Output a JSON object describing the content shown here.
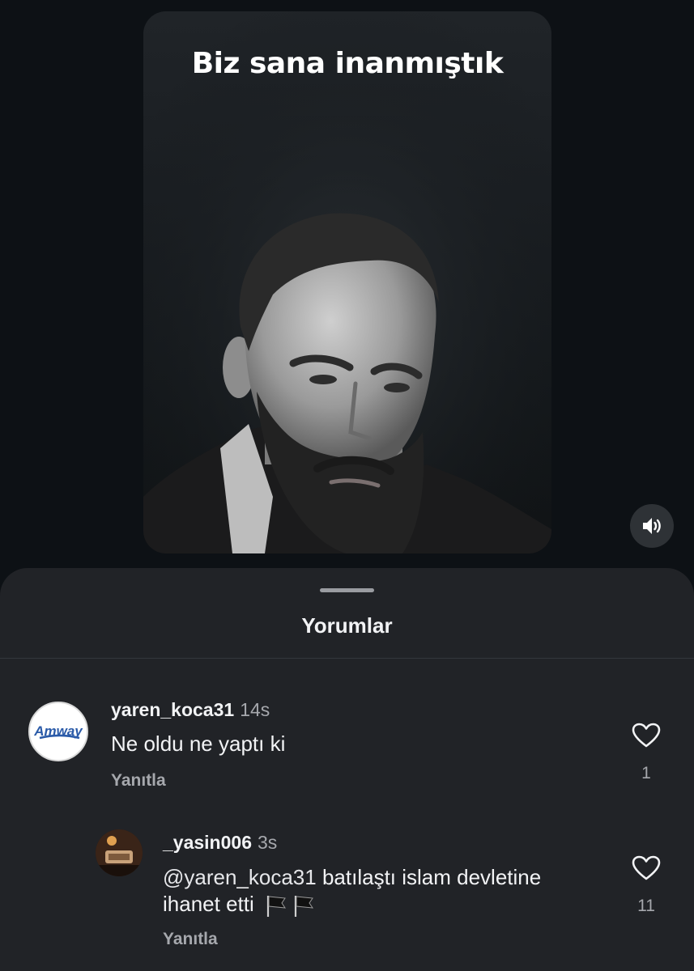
{
  "video": {
    "title": "Biz sana inanmıştık",
    "sound_icon": "speaker-icon"
  },
  "comments_sheet": {
    "title": "Yorumlar"
  },
  "comments": [
    {
      "username": "yaren_koca31",
      "time": "14s",
      "text": "Ne oldu ne yaptı ki",
      "reply_label": "Yanıtla",
      "likes": "1",
      "avatar_text": "Amway"
    },
    {
      "username": "_yasin006",
      "time": "3s",
      "mention": "@yaren_koca31",
      "text_line1": "batılaştı islam devletine",
      "text_line2": "ihanet etti",
      "reply_label": "Yanıtla",
      "likes": "11"
    }
  ],
  "colors": {
    "background": "#0d1115",
    "sheet": "#212327",
    "muted_text": "#a6a8ad"
  }
}
